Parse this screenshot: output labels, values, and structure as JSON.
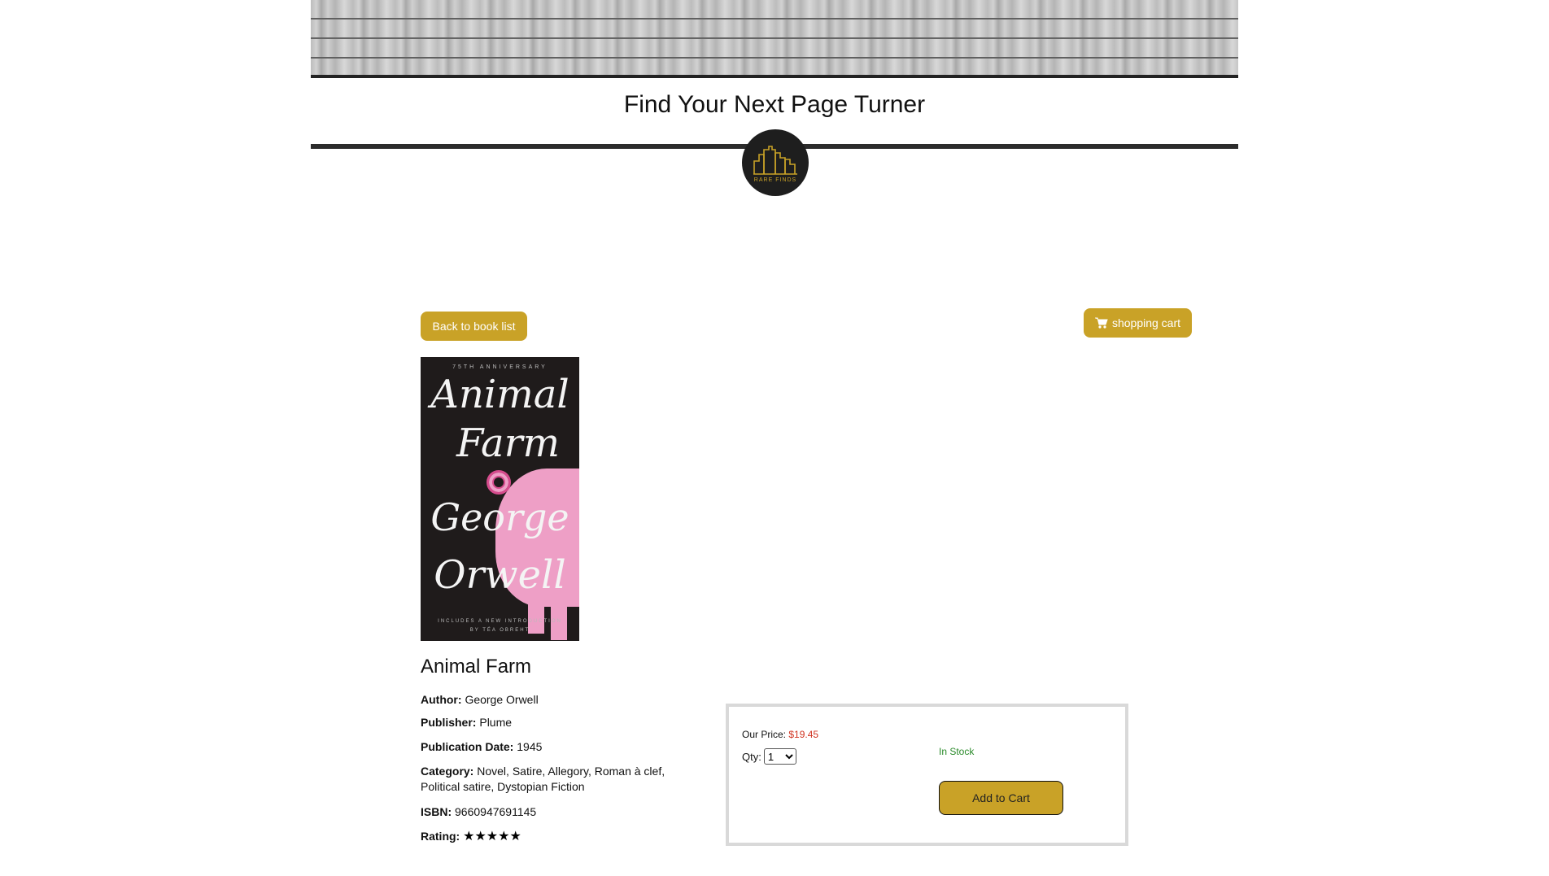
{
  "header": {
    "title": "Find Your Next Page Turner",
    "logo_text": "RARE FINDS"
  },
  "nav": {
    "back_label": "Back to book list",
    "cart_label": "shopping cart"
  },
  "book": {
    "cover": {
      "anniversary": "75TH ANNIVERSARY",
      "title_line1": "Animal",
      "title_line2": "Farm",
      "author_line1": "George",
      "author_line2": "Orwell",
      "intro_line1": "INCLUDES A NEW INTRODUCTION",
      "intro_line2": "BY TÉA OBREHT"
    },
    "title": "Animal Farm",
    "author_label": "Author:",
    "author": "George Orwell",
    "publisher_label": "Publisher:",
    "publisher": "Plume",
    "date_label": "Publication Date:",
    "date": "1945",
    "category_label": "Category:",
    "category": "Novel, Satire, Allegory, Roman à clef, Political satire, Dystopian Fiction",
    "isbn_label": "ISBN:",
    "isbn": "9660947691145",
    "rating_label": "Rating:",
    "rating": 5,
    "rating_max": 5,
    "rating_stars": "★★★★★"
  },
  "purchase": {
    "price_label": "Our Price:",
    "price": "$19.45",
    "qty_label": "Qty:",
    "qty_value": "1",
    "stock_status": "In Stock",
    "add_label": "Add to Cart"
  },
  "colors": {
    "accent": "#c9a227",
    "price": "#d0321f",
    "stock": "#2a8a2a"
  }
}
